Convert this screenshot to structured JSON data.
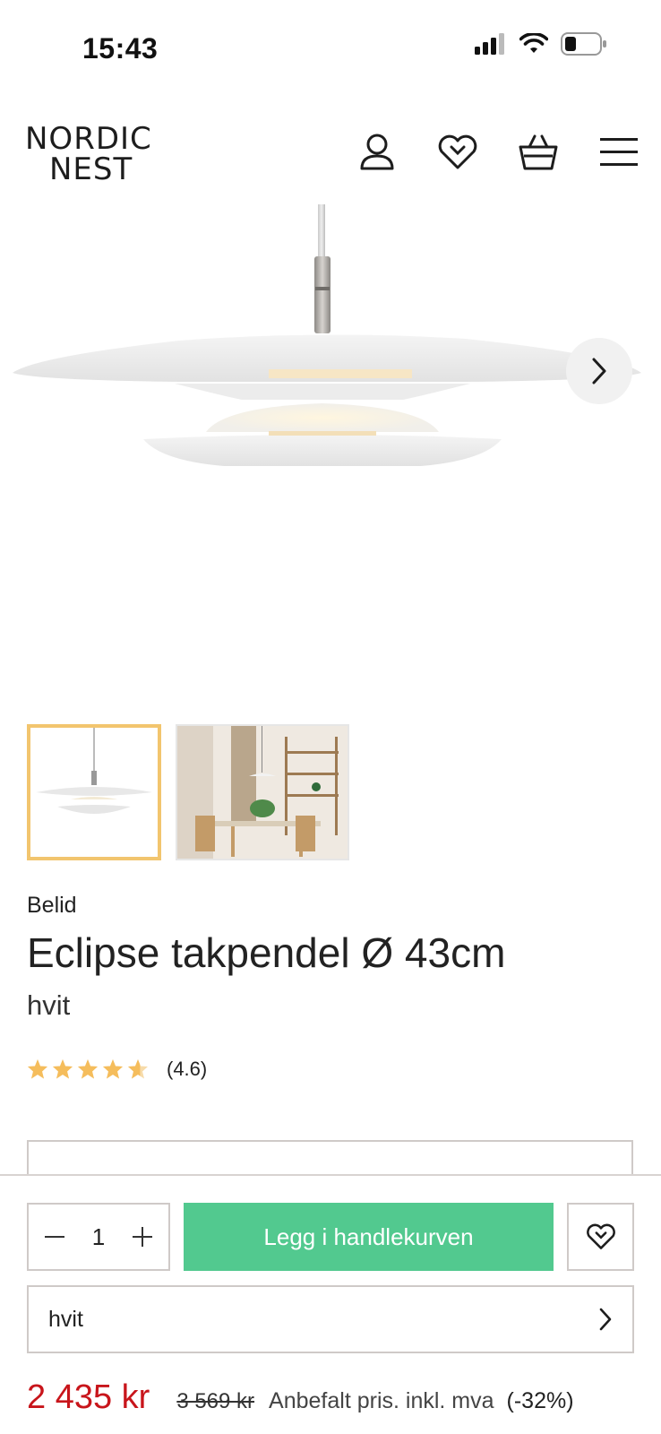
{
  "status": {
    "time": "15:43"
  },
  "header": {
    "logo_line1": "NORDIC",
    "logo_line2": "NEST",
    "icons": [
      "user-icon",
      "wishlist-heart-icon",
      "basket-icon",
      "menu-icon"
    ]
  },
  "gallery": {
    "next_icon": "chevron-right-icon",
    "thumbnails": [
      "pendant-lamp-product",
      "pendant-lamp-dining-room"
    ],
    "active_thumbnail": 0
  },
  "product": {
    "brand": "Belid",
    "title": "Eclipse takpendel Ø 43cm",
    "variant": "hvit",
    "rating": 4.6,
    "rating_text": "(4.6)"
  },
  "purchase": {
    "quantity": "1",
    "add_to_cart_label": "Legg i handlekurven",
    "selected_variant": "hvit",
    "price": "2 435 kr",
    "old_price": "3 569 kr",
    "price_note": "Anbefalt pris. inkl. mva",
    "discount": "(-32%)"
  },
  "colors": {
    "accent_green": "#52c98f",
    "price_red": "#c8151b",
    "thumb_active": "#f2c56e",
    "star": "#f5bd5c"
  }
}
